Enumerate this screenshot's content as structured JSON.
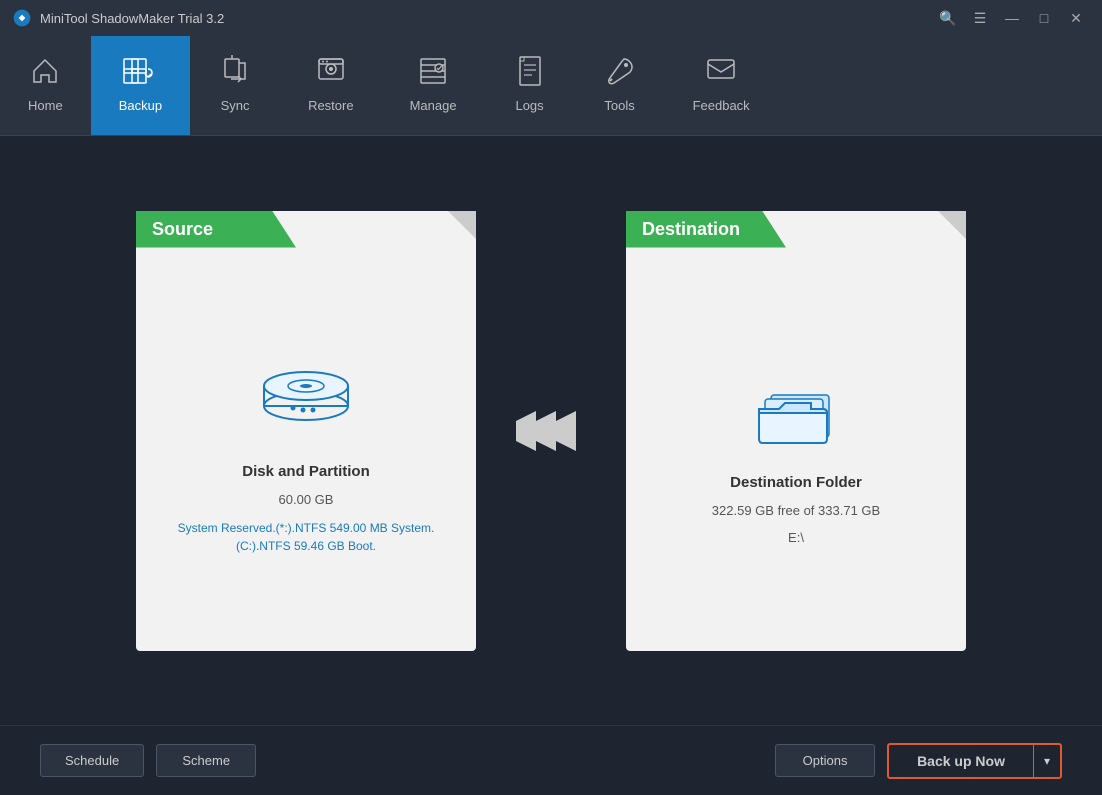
{
  "titlebar": {
    "title": "MiniTool ShadowMaker Trial 3.2",
    "controls": {
      "search": "🔍",
      "menu": "☰",
      "minimize": "—",
      "maximize": "□",
      "close": "✕"
    }
  },
  "navbar": {
    "items": [
      {
        "id": "home",
        "label": "Home",
        "active": false
      },
      {
        "id": "backup",
        "label": "Backup",
        "active": true
      },
      {
        "id": "sync",
        "label": "Sync",
        "active": false
      },
      {
        "id": "restore",
        "label": "Restore",
        "active": false
      },
      {
        "id": "manage",
        "label": "Manage",
        "active": false
      },
      {
        "id": "logs",
        "label": "Logs",
        "active": false
      },
      {
        "id": "tools",
        "label": "Tools",
        "active": false
      },
      {
        "id": "feedback",
        "label": "Feedback",
        "active": false
      }
    ]
  },
  "source": {
    "header": "Source",
    "title": "Disk and Partition",
    "size": "60.00 GB",
    "detail": "System Reserved.(*:).NTFS 549.00 MB System.\n(C:).NTFS 59.46 GB Boot."
  },
  "arrows": "❯❯❯",
  "destination": {
    "header": "Destination",
    "title": "Destination Folder",
    "free": "322.59 GB free of 333.71 GB",
    "path": "E:\\"
  },
  "footer": {
    "schedule_label": "Schedule",
    "scheme_label": "Scheme",
    "options_label": "Options",
    "backup_now_label": "Back up Now",
    "dropdown_arrow": "▾"
  }
}
